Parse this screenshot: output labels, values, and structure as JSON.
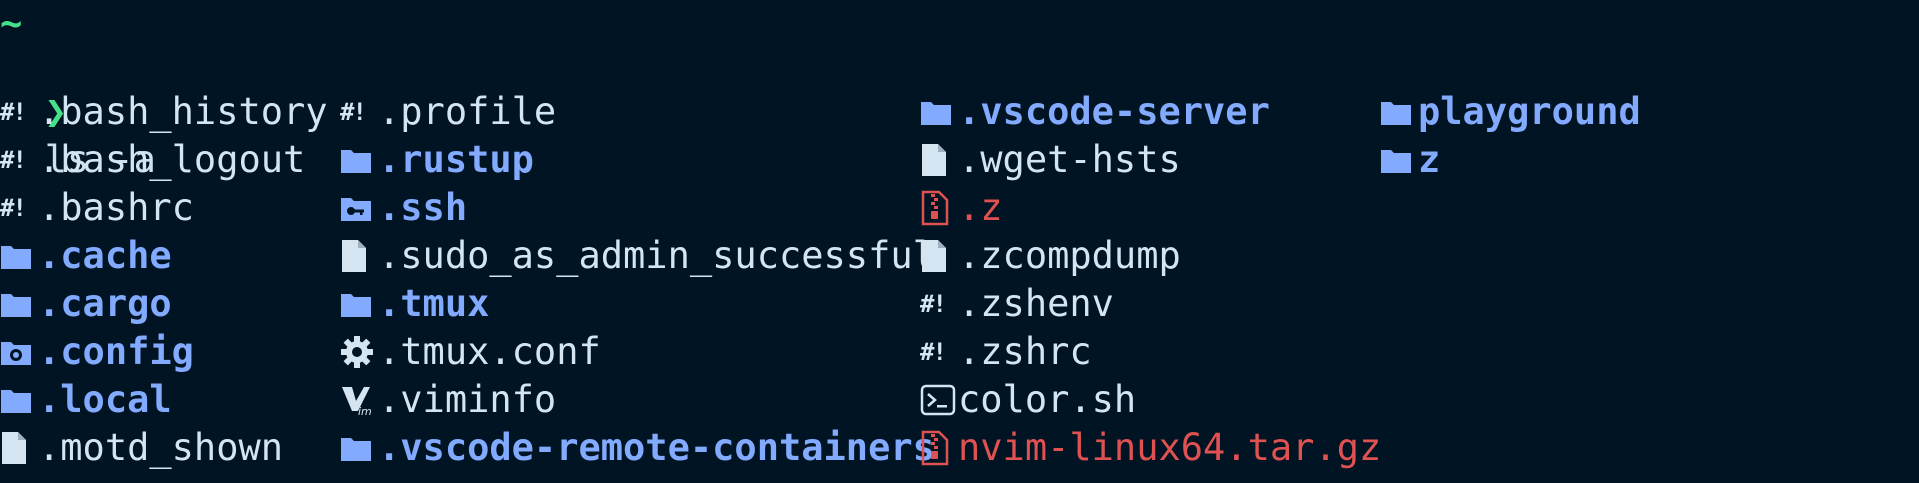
{
  "terminal": {
    "tilde": "~",
    "prompt_symbol": "❯",
    "command": "ls -a",
    "colors": {
      "background": "#011423",
      "prompt": "#44e18b",
      "directory": "#82aaff",
      "file": "#d5e4f1",
      "archive": "#e05252"
    }
  },
  "listing": [
    {
      "name": ".bash_history",
      "type": "file",
      "icon": "shell-script-icon"
    },
    {
      "name": ".bash_logout",
      "type": "file",
      "icon": "shell-script-icon"
    },
    {
      "name": ".bashrc",
      "type": "file",
      "icon": "shell-script-icon"
    },
    {
      "name": ".cache",
      "type": "dir",
      "icon": "folder-icon"
    },
    {
      "name": ".cargo",
      "type": "dir",
      "icon": "folder-icon"
    },
    {
      "name": ".config",
      "type": "dir",
      "icon": "folder-config-icon"
    },
    {
      "name": ".local",
      "type": "dir",
      "icon": "folder-icon"
    },
    {
      "name": ".motd_shown",
      "type": "file",
      "icon": "file-icon"
    },
    {
      "name": ".profile",
      "type": "file",
      "icon": "shell-script-icon"
    },
    {
      "name": ".rustup",
      "type": "dir",
      "icon": "folder-icon"
    },
    {
      "name": ".ssh",
      "type": "dir",
      "icon": "folder-key-icon"
    },
    {
      "name": ".sudo_as_admin_successful",
      "type": "file",
      "icon": "file-icon"
    },
    {
      "name": ".tmux",
      "type": "dir",
      "icon": "folder-icon"
    },
    {
      "name": ".tmux.conf",
      "type": "file",
      "icon": "gear-icon"
    },
    {
      "name": ".viminfo",
      "type": "file",
      "icon": "vim-icon"
    },
    {
      "name": ".vscode-remote-containers",
      "type": "dir",
      "icon": "folder-icon"
    },
    {
      "name": ".vscode-server",
      "type": "dir",
      "icon": "folder-icon"
    },
    {
      "name": ".wget-hsts",
      "type": "file",
      "icon": "file-icon"
    },
    {
      "name": ".z",
      "type": "archive",
      "icon": "zip-icon"
    },
    {
      "name": ".zcompdump",
      "type": "file",
      "icon": "file-icon"
    },
    {
      "name": ".zshenv",
      "type": "file",
      "icon": "shell-script-icon"
    },
    {
      "name": ".zshrc",
      "type": "file",
      "icon": "shell-script-icon"
    },
    {
      "name": "color.sh",
      "type": "file",
      "icon": "terminal-icon"
    },
    {
      "name": "nvim-linux64.tar.gz",
      "type": "archive",
      "icon": "zip-icon"
    },
    {
      "name": "playground",
      "type": "dir",
      "icon": "folder-icon"
    },
    {
      "name": "z",
      "type": "dir",
      "icon": "folder-icon"
    }
  ]
}
